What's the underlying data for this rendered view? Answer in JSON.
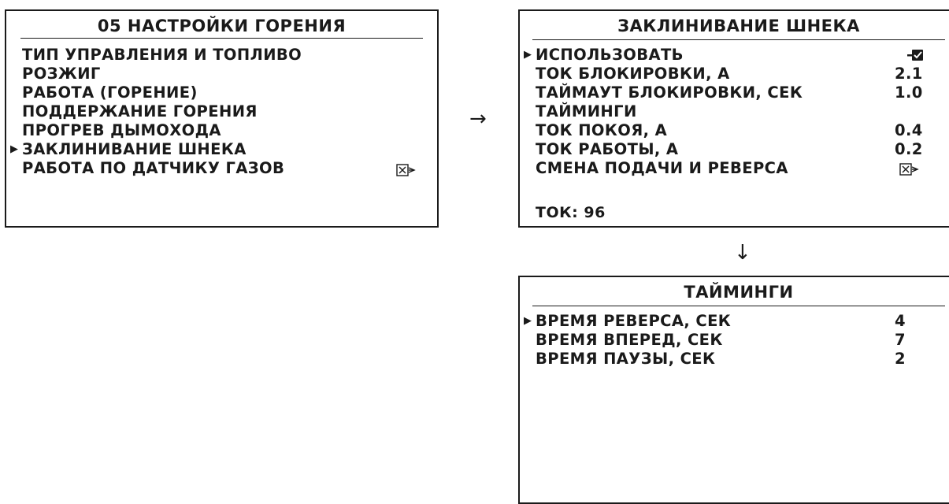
{
  "combustion_menu": {
    "title": "05 НАСТРОЙКИ ГОРЕНИЯ",
    "items": [
      {
        "label": "ТИП УПРАВЛЕНИЯ И ТОПЛИВО"
      },
      {
        "label": "РОЗЖИГ"
      },
      {
        "label": "РАБОТА (ГОРЕНИЕ)"
      },
      {
        "label": "ПОДДЕРЖАНИЕ ГОРЕНИЯ"
      },
      {
        "label": "ПРОГРЕВ ДЫМОХОДА"
      },
      {
        "label": "ЗАКЛИНИВАНИЕ ШНЕКА"
      },
      {
        "label": "РАБОТА ПО ДАТЧИКУ ГАЗОВ",
        "status_icon": "disabled-box-icon"
      }
    ],
    "selected_index": 5
  },
  "jamming_menu": {
    "title": "ЗАКЛИНИВАНИЕ ШНЕКА",
    "items": [
      {
        "label": "ИСПОЛЬЗОВАТЬ",
        "status_icon": "checked-box-icon"
      },
      {
        "label": "ТОК БЛОКИРОВКИ, А",
        "value": "2.1"
      },
      {
        "label": "ТАЙМАУТ БЛОКИРОВКИ, СЕК",
        "value": "1.0"
      },
      {
        "label": "ТАЙМИНГИ"
      },
      {
        "label": "ТОК ПОКОЯ, А",
        "value": "0.4"
      },
      {
        "label": "ТОК РАБОТЫ, А",
        "value": "0.2"
      },
      {
        "label": "СМЕНА ПОДАЧИ И РЕВЕРСА",
        "status_icon": "disabled-box-icon"
      }
    ],
    "selected_index": 0,
    "footer": "ТОК: 96"
  },
  "timings_menu": {
    "title": "ТАЙМИНГИ",
    "items": [
      {
        "label": "ВРЕМЯ РЕВЕРСА, СЕК",
        "value": "4"
      },
      {
        "label": "ВРЕМЯ ВПЕРЕД, СЕК",
        "value": "7"
      },
      {
        "label": "ВРЕМЯ ПАУЗЫ, СЕК",
        "value": "2"
      }
    ],
    "selected_index": 0
  },
  "flow": {
    "right_arrow": "→",
    "down_arrow": "↓",
    "cursor_glyph": "▶"
  }
}
